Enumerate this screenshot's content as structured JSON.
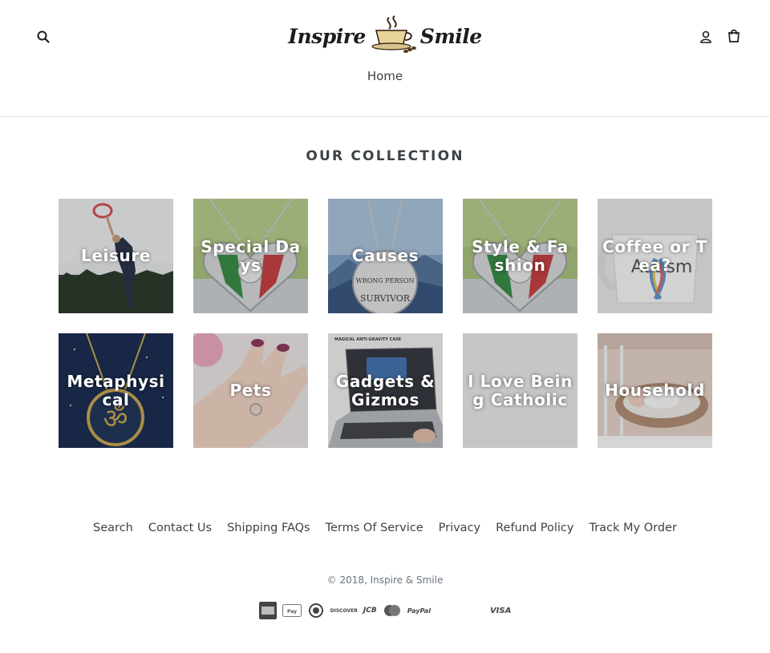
{
  "header": {
    "logo_left": "Inspire",
    "logo_right": "Smile",
    "nav_home": "Home"
  },
  "collection": {
    "title": "OUR COLLECTION",
    "items": [
      {
        "label": "Leisure",
        "image": "frisbee-jumper"
      },
      {
        "label": "Special Days",
        "image": "heart-pendant-italy"
      },
      {
        "label": "Causes",
        "image": "survivor-pendant-mountains"
      },
      {
        "label": "Style & Fashion",
        "image": "heart-pendant-italy"
      },
      {
        "label": "Coffee or Tea?",
        "image": "autism-mug"
      },
      {
        "label": "Metaphysical",
        "image": "om-pendant-night-sky"
      },
      {
        "label": "Pets",
        "image": "paw-ring-hand"
      },
      {
        "label": "Gadgets & Gizmos",
        "image": "laptop-phone-case",
        "caption": "MAGICAL ANTI-GRAVITY CASE"
      },
      {
        "label": "I Love Being Catholic",
        "image": "blank-grey"
      },
      {
        "label": "Household",
        "image": "baby-in-crib"
      }
    ]
  },
  "footer": {
    "links": [
      "Search",
      "Contact Us",
      "Shipping FAQs",
      "Terms Of Service",
      "Privacy",
      "Refund Policy",
      "Track My Order"
    ],
    "copyright": "© 2018, Inspire & Smile",
    "payments": [
      "american-express",
      "apple-pay",
      "diners-club",
      "discover",
      "jcb",
      "master",
      "paypal",
      "visa"
    ],
    "payment_labels": {
      "discover": "DISCOVER",
      "jcb": "JCB",
      "paypal": "PayPal",
      "visa": "VISA"
    }
  },
  "colors": {
    "text": "#3d4246",
    "muted": "#69727b",
    "border": "#e8e9eb"
  }
}
